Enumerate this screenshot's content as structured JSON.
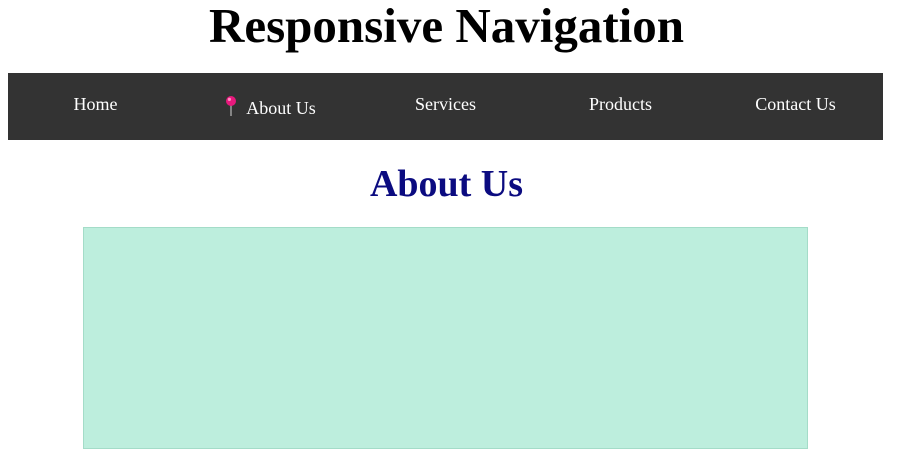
{
  "page": {
    "title": "Responsive Navigation"
  },
  "nav": {
    "items": [
      {
        "label": "Home",
        "active": false
      },
      {
        "label": "About Us",
        "active": true,
        "icon": "pushpin-icon"
      },
      {
        "label": "Services",
        "active": false
      },
      {
        "label": "Products",
        "active": false
      },
      {
        "label": "Contact Us",
        "active": false
      }
    ]
  },
  "main": {
    "heading": "About Us"
  },
  "colors": {
    "nav_background": "#333333",
    "heading": "#0b0b80",
    "content_box": "#bdeedd",
    "pin": "#e8197d"
  }
}
